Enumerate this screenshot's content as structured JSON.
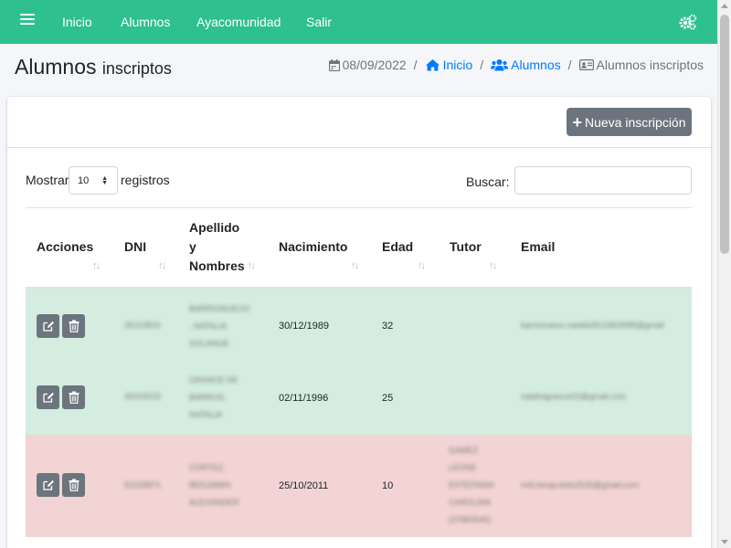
{
  "navbar": {
    "color": "#2fc08f",
    "menu_icon": "bars-icon",
    "links": [
      "Inicio",
      "Alumnos",
      "Ayacomunidad",
      "Salir"
    ],
    "settings_icon": "cogs-icon"
  },
  "page": {
    "title": "Alumnos",
    "subtitle": "inscriptos"
  },
  "breadcrumb": {
    "date": "08/09/2022",
    "items": [
      "Inicio",
      "Alumnos",
      "Alumnos inscriptos"
    ],
    "link_color": "#007bff"
  },
  "card": {
    "new_button_label": "Nueva inscripción"
  },
  "table_controls": {
    "show_label": "Mostrar",
    "page_length": "10",
    "records_label": "registros",
    "search_label": "Buscar:",
    "search_value": ""
  },
  "table": {
    "headers": [
      "Acciones",
      "DNI",
      "Apellido y Nombres",
      "Nacimiento",
      "Edad",
      "Tutor",
      "Email"
    ],
    "header_lines": {
      "apellido": [
        "Apellido",
        "y",
        "Nombres"
      ]
    },
    "rows": [
      {
        "status_color": "#d4ede0",
        "dni": "35110819",
        "name_lines": [
          "BARRIONUEVO",
          ", NATALIA",
          "SOLANGE"
        ],
        "birth": "30/12/1989",
        "age": "32",
        "tutor_lines": [],
        "email": "barrionuevo.natalia3511863998@gmail"
      },
      {
        "status_color": "#d4ede0",
        "dni": "40015015",
        "name_lines": [
          "GRANCE DE",
          "BARROS,",
          "NATALIA"
        ],
        "birth": "02/11/1996",
        "age": "25",
        "tutor_lines": [],
        "email": "natahagrance02@gmail.com"
      },
      {
        "status_color": "#f2d4d4",
        "dni": "52159871",
        "name_lines": [
          "CORTEZ,",
          "BENJAMIN",
          "ALEXANDER"
        ],
        "birth": "25/10/2011",
        "age": "10",
        "tutor_lines": [
          "GAMEZ",
          "LEONE",
          "ESTEFANIA",
          "CAROLINA",
          "(37860546)"
        ],
        "email": "m4l.benja.beto2525@gmail.com"
      }
    ]
  }
}
